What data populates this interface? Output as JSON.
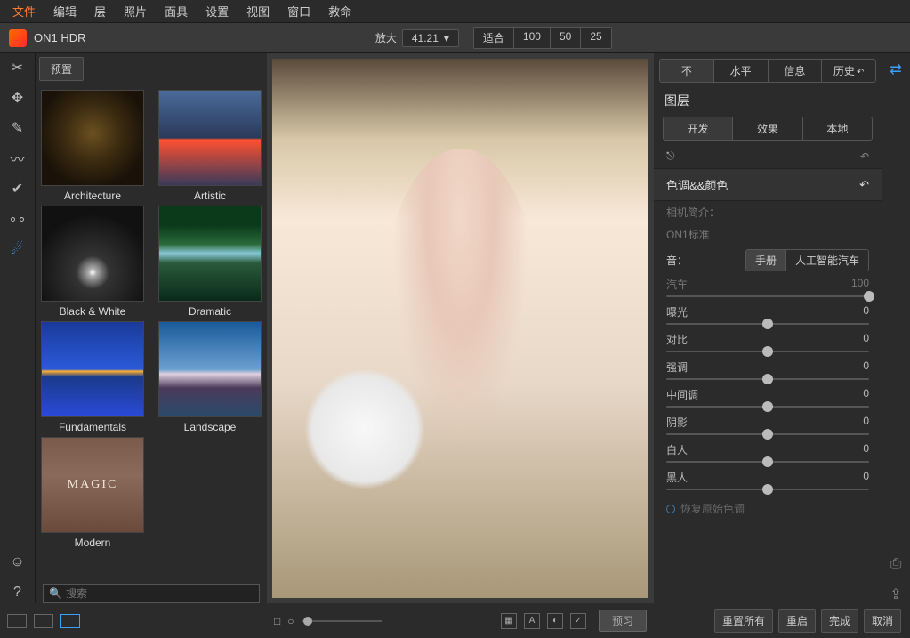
{
  "menubar": [
    "文件",
    "编辑",
    "层",
    "照片",
    "面具",
    "设置",
    "视图",
    "窗口",
    "救命"
  ],
  "app_name": "ON1 HDR",
  "zoom": {
    "label": "放大",
    "value": "41.21",
    "buttons": [
      "适合",
      "100",
      "50",
      "25"
    ]
  },
  "presets": {
    "header": "预置",
    "items": [
      {
        "label": "Architecture",
        "cls": "th-arch"
      },
      {
        "label": "Artistic",
        "cls": "th-art"
      },
      {
        "label": "Black & White",
        "cls": "th-bw"
      },
      {
        "label": "Dramatic",
        "cls": "th-dram"
      },
      {
        "label": "Fundamentals",
        "cls": "th-fund"
      },
      {
        "label": "Landscape",
        "cls": "th-land"
      },
      {
        "label": "Modern",
        "cls": "th-mod",
        "inner": "MAGIC"
      }
    ],
    "search_placeholder": "搜索"
  },
  "right": {
    "main_tabs": [
      "不",
      "水平",
      "信息",
      "历史"
    ],
    "main_active": 0,
    "title": "图层",
    "sub_tabs": [
      "开发",
      "效果",
      "本地"
    ],
    "sub_active": 0,
    "section_title": "色调&&颜色",
    "camera_label": "相机简介：",
    "camera_value": "ON1标准",
    "tone_label": "音：",
    "tone_buttons": [
      "手册",
      "人工智能汽车"
    ],
    "tone_active": 0,
    "auto_slider": {
      "label": "汽车",
      "value": "100",
      "pos": "end"
    },
    "sliders": [
      {
        "label": "曝光",
        "value": "0",
        "pos": "mid"
      },
      {
        "label": "对比",
        "value": "0",
        "pos": "mid"
      },
      {
        "label": "强调",
        "value": "0",
        "pos": "mid"
      },
      {
        "label": "中间调",
        "value": "0",
        "pos": "mid"
      },
      {
        "label": "阴影",
        "value": "0",
        "pos": "mid"
      },
      {
        "label": "白人",
        "value": "0",
        "pos": "mid"
      },
      {
        "label": "黑人",
        "value": "0",
        "pos": "mid"
      }
    ],
    "restore_label": "恢复原始色调"
  },
  "bottom": {
    "preview_label": "预习",
    "actions": [
      "重置所有",
      "重启",
      "完成",
      "取消"
    ]
  }
}
